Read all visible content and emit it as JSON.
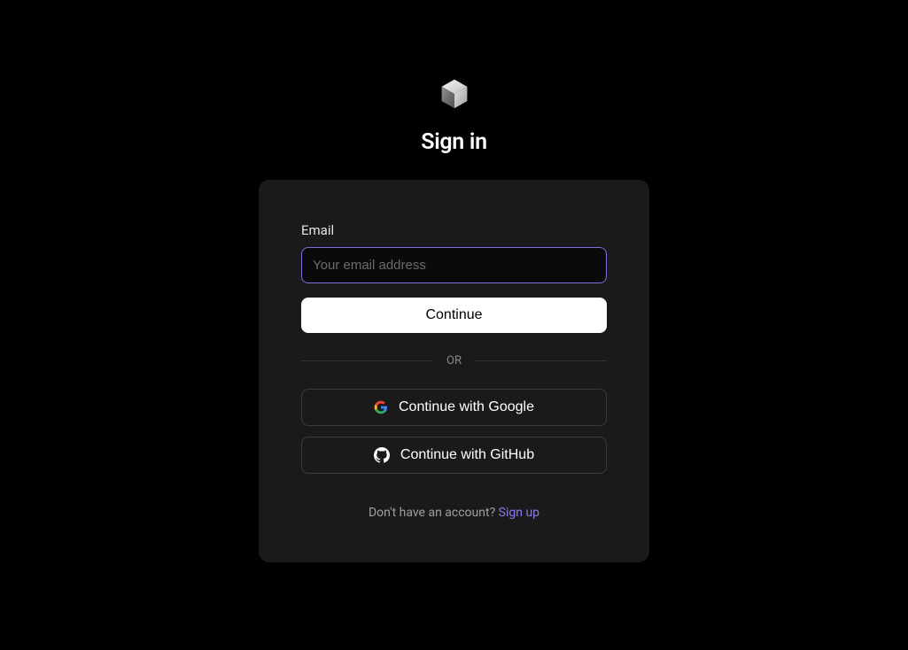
{
  "header": {
    "title": "Sign in"
  },
  "form": {
    "email_label": "Email",
    "email_placeholder": "Your email address",
    "email_value": "",
    "continue_label": "Continue"
  },
  "divider": {
    "text": "OR"
  },
  "oauth": {
    "google_label": "Continue with Google",
    "github_label": "Continue with GitHub"
  },
  "footer": {
    "prompt": "Don't have an account? ",
    "signup_link": "Sign up"
  },
  "colors": {
    "background": "#000000",
    "card_bg": "#1a1a1a",
    "input_border_active": "#7c6fde",
    "link": "#8a7cf0"
  }
}
